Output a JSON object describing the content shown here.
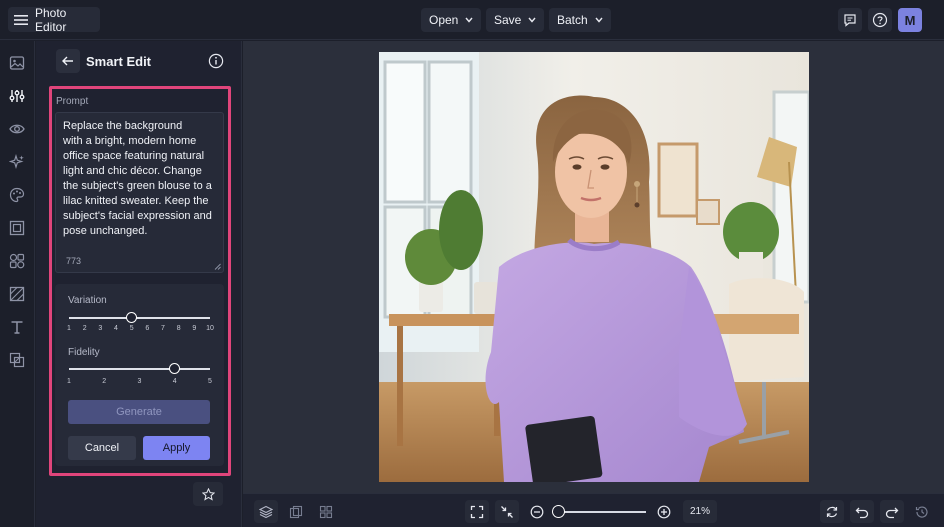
{
  "header": {
    "app_title": "Photo Editor",
    "menus": [
      {
        "label": "Open"
      },
      {
        "label": "Save"
      },
      {
        "label": "Batch"
      }
    ],
    "avatar_initial": "M"
  },
  "rail": {
    "items": [
      "image-icon",
      "adjust-sliders-icon",
      "eye-icon",
      "magic-sparkle-icon",
      "palette-icon",
      "frame-icon",
      "shapes-icon",
      "texture-icon",
      "text-icon",
      "overlay-icon"
    ],
    "active": "adjust-sliders-icon"
  },
  "panel": {
    "title": "Smart Edit",
    "prompt_label": "Prompt",
    "prompt_text": "Replace the background\nwith a bright, modern home\noffice space featuring natural\nlight and chic décor. Change\nthe subject's green blouse to a\nlilac knitted sweater. Keep the\nsubject's facial expression and\npose unchanged.",
    "char_count": "773",
    "variation": {
      "label": "Variation",
      "ticks": [
        "1",
        "2",
        "3",
        "4",
        "5",
        "6",
        "7",
        "8",
        "9",
        "10"
      ],
      "value": 5
    },
    "fidelity": {
      "label": "Fidelity",
      "ticks": [
        "1",
        "2",
        "3",
        "4",
        "5"
      ],
      "value": 4
    },
    "generate_label": "Generate",
    "cancel_label": "Cancel",
    "apply_label": "Apply"
  },
  "bottom": {
    "zoom_level": "21%",
    "zoom_fraction": 0.02
  },
  "colors": {
    "accent": "#7d84f2",
    "highlight_outline": "#e0457b",
    "background": "#1c1f2a",
    "canvas_bg": "#2b2f3b",
    "sweater": "#b79ad9"
  }
}
